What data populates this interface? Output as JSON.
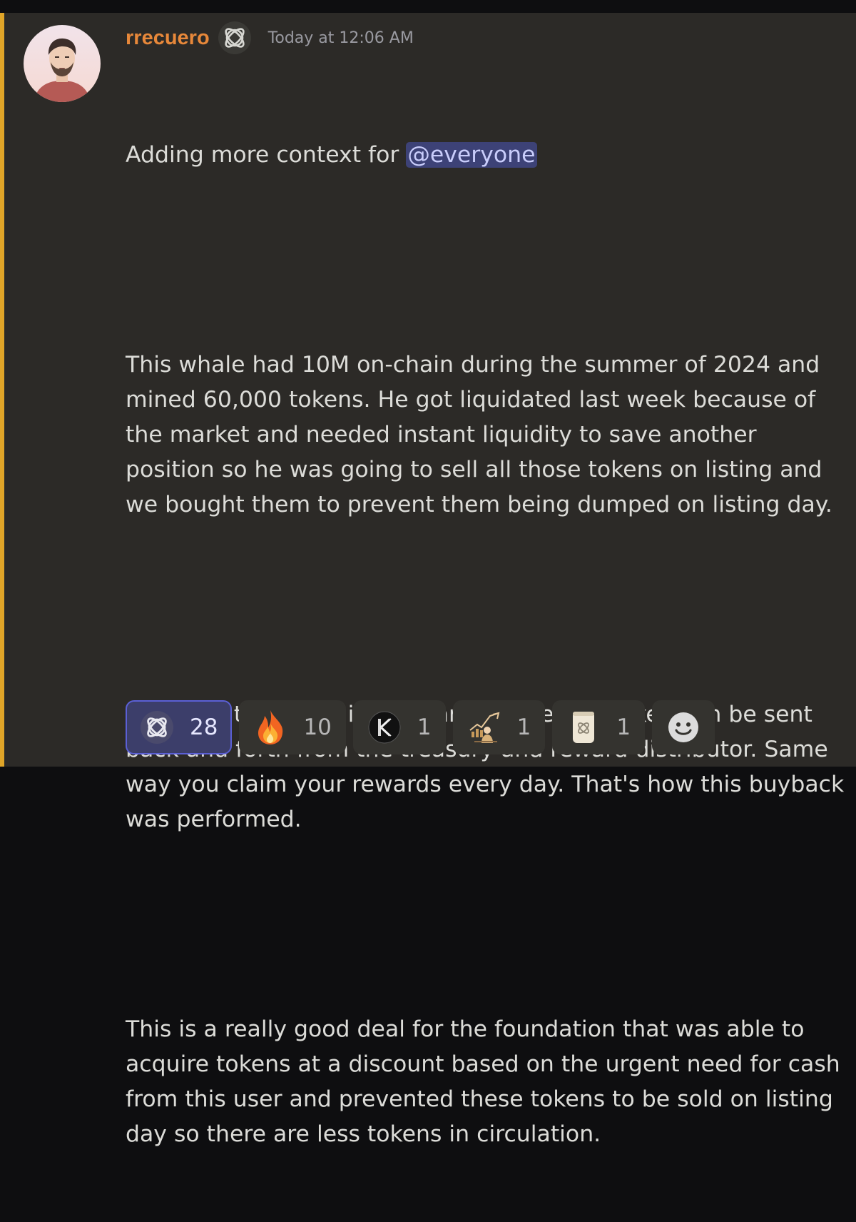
{
  "message": {
    "username": "rrecuero",
    "timestamp": "Today at 12:06 AM",
    "mention": "@everyone",
    "paragraphs": [
      "Adding more context for ",
      "This whale had 10M on-chain during the summer of 2024 and mined 60,000 tokens. He got liquidated last week because of the market and needed instant liquidity to save another position so he was going to sell all those tokens on listing and we bought them to prevent them being dumped on listing day.",
      "Although the token is not transferable yet, token can be sent back and forth from the treasury and reward distributor. Same way you claim your rewards every day. That's how this buyback was performed.",
      "This is a really good deal for the foundation that was able to acquire tokens at a discount based on the urgent need for cash from this user and prevented these tokens to be sold on listing day so there are less tokens in circulation."
    ]
  },
  "reactions": [
    {
      "emoji": "knot-logo-emoji",
      "count": "28",
      "active": true
    },
    {
      "emoji": "fire-emoji",
      "count": "10",
      "active": false
    },
    {
      "emoji": "k-logo-emoji",
      "count": "1",
      "active": false
    },
    {
      "emoji": "chart-figure-emoji",
      "count": "1",
      "active": false
    },
    {
      "emoji": "cup-logo-emoji",
      "count": "1",
      "active": false
    }
  ],
  "icons": {
    "role_icon": "knot-logo-icon",
    "add_reaction": "smiley-face-icon"
  },
  "colors": {
    "background": "#2c2a27",
    "mention_bar": "#e0a528",
    "username": "#e8883a",
    "mention_bg": "#3d4277",
    "active_reaction_border": "#5b60d6"
  }
}
